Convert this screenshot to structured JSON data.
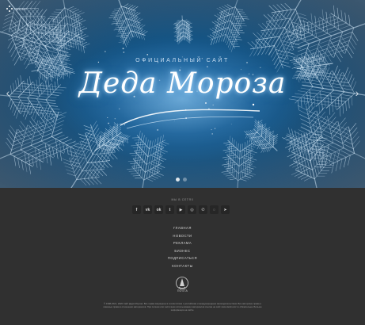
{
  "header": {
    "menu_label": "МЕНЮ"
  },
  "hero": {
    "subtitle": "ОФИЦИАЛЬНЫЙ САЙТ",
    "logo_text": "Деда Мороза",
    "prev_arrow": "‹",
    "next_arrow": "›",
    "slides_count": 2,
    "active_slide": 1
  },
  "footer": {
    "social_title": "МЫ В СЕТЯХ",
    "social": [
      {
        "name": "facebook",
        "glyph": "f"
      },
      {
        "name": "vkontakte",
        "glyph": "vk"
      },
      {
        "name": "odnoklassniki",
        "glyph": "ok"
      },
      {
        "name": "twitter",
        "glyph": "t"
      },
      {
        "name": "youtube",
        "glyph": "▶"
      },
      {
        "name": "instagram",
        "glyph": "◎"
      },
      {
        "name": "viber",
        "glyph": "✆"
      },
      {
        "name": "whatsapp",
        "glyph": "◌"
      },
      {
        "name": "telegram",
        "glyph": "➤"
      }
    ],
    "nav": [
      "ГЛАВНАЯ",
      "НОВОСТИ",
      "РЕКЛАМА",
      "БИЗНЕС",
      "ПОДПИСАТЬСЯ",
      "КОНТАКТЫ"
    ],
    "logo_caption": "ПОЧТА",
    "copyright": "© 1998-2021, 2020 Сайт Деда Мороза. Все права защищены в соответствии с российским и международным законодательством. Все авторские права и смежные права в отношении материалов. При полном или частичном использовании материалов ссылка на сайт www.dedmoroz.ru обязательна. Больше информации на сайте."
  },
  "colors": {
    "hero_dark": "#082741",
    "hero_mid": "#1d6aa6",
    "footer_bg": "#303030",
    "social_btn_bg": "#262626"
  }
}
